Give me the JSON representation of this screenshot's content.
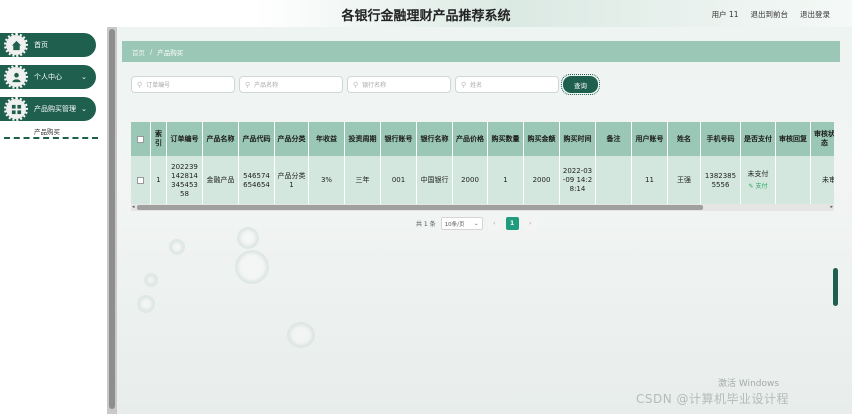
{
  "header": {
    "title": "各银行金融理财产品推荐系统",
    "user_label": "用户 11",
    "exit_front_label": "退出到前台",
    "logout_label": "退出登录"
  },
  "sidebar": {
    "items": [
      {
        "label": "首页",
        "icon": "home-icon"
      },
      {
        "label": "个人中心",
        "icon": "person-icon",
        "chevron": "⌄"
      },
      {
        "label": "产品购买管理",
        "icon": "grid-icon",
        "chevron": "⌄"
      }
    ],
    "subitem": "产品购买"
  },
  "breadcrumb": {
    "home": "首页",
    "separator": "/",
    "current": "产品购买"
  },
  "search": {
    "order_placeholder": "订单编号",
    "product_name_placeholder": "产品名称",
    "bank_name_placeholder": "银行名称",
    "name_placeholder": "姓名",
    "query_label": "查询"
  },
  "table": {
    "headers": [
      "索引",
      "订单编号",
      "产品名称",
      "产品代码",
      "产品分类",
      "年收益",
      "投资周期",
      "银行账号",
      "银行名称",
      "产品价格",
      "购买数量",
      "购买金额",
      "购买时间",
      "备注",
      "用户账号",
      "姓名",
      "手机号码",
      "是否支付",
      "审核回复",
      "审核状态"
    ],
    "rows": [
      {
        "index": "1",
        "order_no": "202239142814345453 58",
        "product_name": "金融产品",
        "product_code": "546574654654",
        "category": "产品分类1",
        "annual_yield": "3%",
        "period": "三年",
        "bank_account": "001",
        "bank_name": "中国银行",
        "price": "2000",
        "quantity": "1",
        "amount": "2000",
        "purchase_time": "2022-03-09 14:28:14",
        "remark": "",
        "user_account": "11",
        "name": "王强",
        "phone": "13823855556",
        "paid_status": "未支付",
        "pay_action": "支付",
        "review_reply": "",
        "review_status": "未审"
      }
    ]
  },
  "pagination": {
    "total": "共 1 条",
    "page_size": "10条/页",
    "prev": "‹",
    "current_page": "1",
    "next": "›"
  },
  "watermarks": {
    "windows": "激活 Windows",
    "csdn": "CSDN @计算机毕业设计程"
  },
  "colors": {
    "brand_dark": "#1f5f4d",
    "header_green": "#9bc7b6",
    "row_green": "#d3e7df",
    "pay_green": "#2aa35a"
  }
}
